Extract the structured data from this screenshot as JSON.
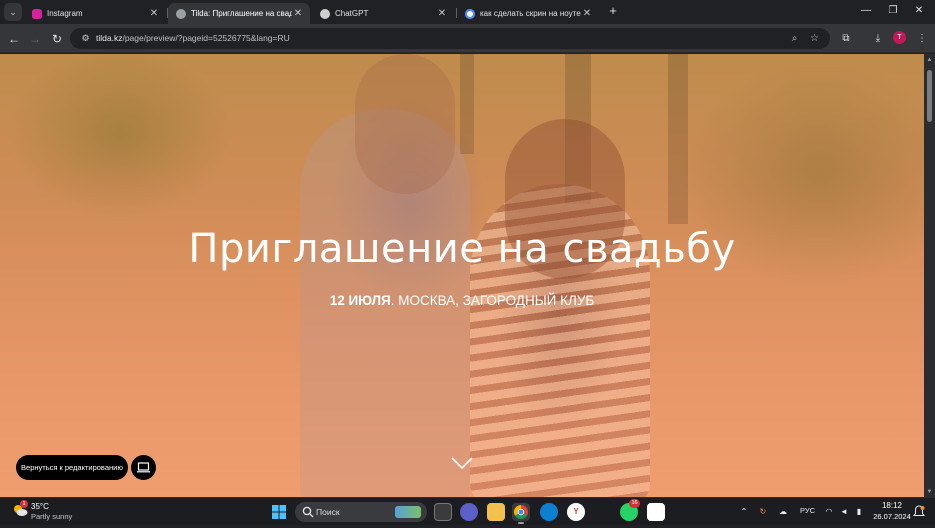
{
  "browser": {
    "tabs": [
      {
        "label": "Instagram",
        "close": "✕",
        "favicon_color": "#d6249f",
        "active": false
      },
      {
        "label": "Tilda: Приглашение на свадьбу",
        "close": "✕",
        "favicon_color": "#9aa0a6",
        "active": true
      },
      {
        "label": "ChatGPT",
        "close": "✕",
        "favicon_color": "#cfcfcf",
        "active": false
      },
      {
        "label": "как сделать скрин на ноуте - Поиск",
        "close": "✕",
        "favicon_color": "#4285f4",
        "active": false
      }
    ],
    "new_tab": "+",
    "url_host": "tilda.kz",
    "url_path": "/page/preview/?pageid=52526775&lang=RU",
    "profile_initial": "T",
    "profile_color": "#c2185b"
  },
  "page": {
    "title": "Приглашение на свадьбу",
    "subtitle_date": "12 ИЮЛЯ",
    "subtitle_rest": ". МОСКВА, ЗАГОРОДНЫЙ КЛУБ",
    "edit_button": "Вернуться к редактированию",
    "accent": "#f0a275"
  },
  "taskbar": {
    "weather_temp": "35°C",
    "weather_condition": "Partly sunny",
    "weather_badge": "1",
    "search_placeholder": "Поиск",
    "whatsapp_badge": "16",
    "language": "РУС",
    "time": "18:12",
    "date": "26.07.2024"
  }
}
